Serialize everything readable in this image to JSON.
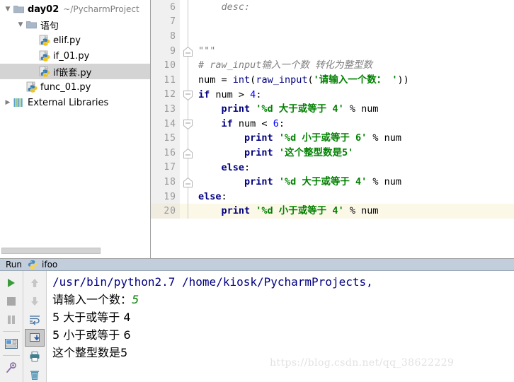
{
  "project": {
    "root": {
      "name": "day02",
      "path": "~/PycharmProject",
      "icon": "folder-icon"
    },
    "items": [
      {
        "name": "语句",
        "icon": "folder-icon",
        "level": 2,
        "twisty": "▼",
        "selected": false,
        "type": "folder"
      },
      {
        "name": "elif.py",
        "icon": "python-file-icon",
        "level": 3,
        "twisty": "",
        "selected": false,
        "type": "file"
      },
      {
        "name": "if_01.py",
        "icon": "python-file-icon",
        "level": 3,
        "twisty": "",
        "selected": false,
        "type": "file"
      },
      {
        "name": "if嵌套.py",
        "icon": "python-file-icon",
        "level": 3,
        "twisty": "",
        "selected": true,
        "type": "file"
      },
      {
        "name": "func_01.py",
        "icon": "python-file-icon",
        "level": 2,
        "twisty": "",
        "selected": false,
        "type": "file"
      },
      {
        "name": "External Libraries",
        "icon": "libraries-icon",
        "level": 1,
        "twisty": "▶",
        "selected": false,
        "type": "libraries"
      }
    ]
  },
  "editor": {
    "highlighted_line": 20,
    "lines": [
      {
        "num": "6",
        "fold": "none",
        "tokens": [
          {
            "t": "    ",
            "c": "plain"
          },
          {
            "t": "desc:",
            "c": "doc"
          }
        ]
      },
      {
        "num": "7",
        "fold": "none",
        "tokens": []
      },
      {
        "num": "8",
        "fold": "none",
        "tokens": []
      },
      {
        "num": "9",
        "fold": "end",
        "tokens": [
          {
            "t": "\"\"\"",
            "c": "doc"
          }
        ]
      },
      {
        "num": "10",
        "fold": "none",
        "tokens": [
          {
            "t": "# raw_input输入一个数 转化为整型数",
            "c": "cmt"
          }
        ]
      },
      {
        "num": "11",
        "fold": "none",
        "tokens": [
          {
            "t": "num ",
            "c": "plain"
          },
          {
            "t": "= ",
            "c": "op"
          },
          {
            "t": "int",
            "c": "fn"
          },
          {
            "t": "(",
            "c": "op"
          },
          {
            "t": "raw_input",
            "c": "fn"
          },
          {
            "t": "(",
            "c": "op"
          },
          {
            "t": "'请输入一个数： '",
            "c": "str"
          },
          {
            "t": "))",
            "c": "op"
          }
        ]
      },
      {
        "num": "12",
        "fold": "start",
        "tokens": [
          {
            "t": "if",
            "c": "kw"
          },
          {
            "t": " num > ",
            "c": "plain"
          },
          {
            "t": "4",
            "c": "num"
          },
          {
            "t": ":",
            "c": "op"
          }
        ]
      },
      {
        "num": "13",
        "fold": "none",
        "tokens": [
          {
            "t": "    ",
            "c": "plain"
          },
          {
            "t": "print",
            "c": "kw"
          },
          {
            "t": " ",
            "c": "plain"
          },
          {
            "t": "'%d 大于或等于 4'",
            "c": "str"
          },
          {
            "t": " % ",
            "c": "plain"
          },
          {
            "t": "num",
            "c": "plain"
          }
        ]
      },
      {
        "num": "14",
        "fold": "start",
        "tokens": [
          {
            "t": "    ",
            "c": "plain"
          },
          {
            "t": "if",
            "c": "kw"
          },
          {
            "t": " num < ",
            "c": "plain"
          },
          {
            "t": "6",
            "c": "num"
          },
          {
            "t": ":",
            "c": "op"
          }
        ]
      },
      {
        "num": "15",
        "fold": "none",
        "tokens": [
          {
            "t": "        ",
            "c": "plain"
          },
          {
            "t": "print",
            "c": "kw"
          },
          {
            "t": " ",
            "c": "plain"
          },
          {
            "t": "'%d 小于或等于 6'",
            "c": "str"
          },
          {
            "t": " % ",
            "c": "plain"
          },
          {
            "t": "num",
            "c": "plain"
          }
        ]
      },
      {
        "num": "16",
        "fold": "end",
        "tokens": [
          {
            "t": "        ",
            "c": "plain"
          },
          {
            "t": "print",
            "c": "kw"
          },
          {
            "t": " ",
            "c": "plain"
          },
          {
            "t": "'这个整型数是5'",
            "c": "str"
          }
        ]
      },
      {
        "num": "17",
        "fold": "none",
        "tokens": [
          {
            "t": "    ",
            "c": "plain"
          },
          {
            "t": "else",
            "c": "kw"
          },
          {
            "t": ":",
            "c": "op"
          }
        ]
      },
      {
        "num": "18",
        "fold": "end",
        "tokens": [
          {
            "t": "        ",
            "c": "plain"
          },
          {
            "t": "print",
            "c": "kw"
          },
          {
            "t": " ",
            "c": "plain"
          },
          {
            "t": "'%d 大于或等于 4'",
            "c": "str"
          },
          {
            "t": " % ",
            "c": "plain"
          },
          {
            "t": "num",
            "c": "plain"
          }
        ]
      },
      {
        "num": "19",
        "fold": "none",
        "tokens": [
          {
            "t": "else",
            "c": "kw"
          },
          {
            "t": ":",
            "c": "op"
          }
        ]
      },
      {
        "num": "20",
        "fold": "none",
        "tokens": [
          {
            "t": "    ",
            "c": "plain"
          },
          {
            "t": "print",
            "c": "kw"
          },
          {
            "t": " ",
            "c": "plain"
          },
          {
            "t": "'%d 小于或等于 4'",
            "c": "str"
          },
          {
            "t": " % ",
            "c": "plain"
          },
          {
            "t": "num",
            "c": "plain"
          }
        ]
      }
    ]
  },
  "run": {
    "tab_label": "Run",
    "config_name": "ifoo",
    "config_icon": "python-icon",
    "toolbar_left": [
      {
        "name": "rerun-button",
        "icon": "play-icon",
        "state": "enabled"
      },
      {
        "name": "stop-button",
        "icon": "stop-icon",
        "state": "disabled"
      },
      {
        "name": "pause-button",
        "icon": "pause-icon",
        "state": "disabled"
      },
      {
        "name": "restore-layout-button",
        "icon": "layout-icon",
        "state": "enabled"
      },
      {
        "name": "pin-tab-button",
        "icon": "pin-icon",
        "state": "enabled"
      }
    ],
    "toolbar_right": [
      {
        "name": "up-stack-button",
        "icon": "arrow-up-icon",
        "state": "disabled"
      },
      {
        "name": "down-stack-button",
        "icon": "arrow-down-icon",
        "state": "disabled"
      },
      {
        "name": "soft-wrap-button",
        "icon": "wrap-icon",
        "state": "enabled"
      },
      {
        "name": "scroll-to-end-button",
        "icon": "scroll-end-icon",
        "state": "pressed"
      },
      {
        "name": "print-button",
        "icon": "printer-icon",
        "state": "enabled"
      },
      {
        "name": "clear-all-button",
        "icon": "trash-icon",
        "state": "enabled"
      }
    ],
    "console": [
      {
        "kind": "path",
        "text": "/usr/bin/python2.7 /home/kiosk/PycharmProjects,"
      },
      {
        "kind": "prompt",
        "prompt": "请输入一个数：",
        "input": "5"
      },
      {
        "kind": "out",
        "text": "5 大于或等于 4"
      },
      {
        "kind": "out",
        "text": "5 小于或等于 6"
      },
      {
        "kind": "out",
        "text": "这个整型数是5"
      }
    ]
  },
  "watermark": {
    "text": "https://blog.csdn.net/qq_38622229"
  },
  "colors": {
    "keyword": "#000080",
    "string": "#008000",
    "number": "#0000ff",
    "comment": "#808080",
    "selection": "#d4d4d4",
    "caret_row": "#fcf8e8",
    "tab_bar": "#c3cedd"
  }
}
